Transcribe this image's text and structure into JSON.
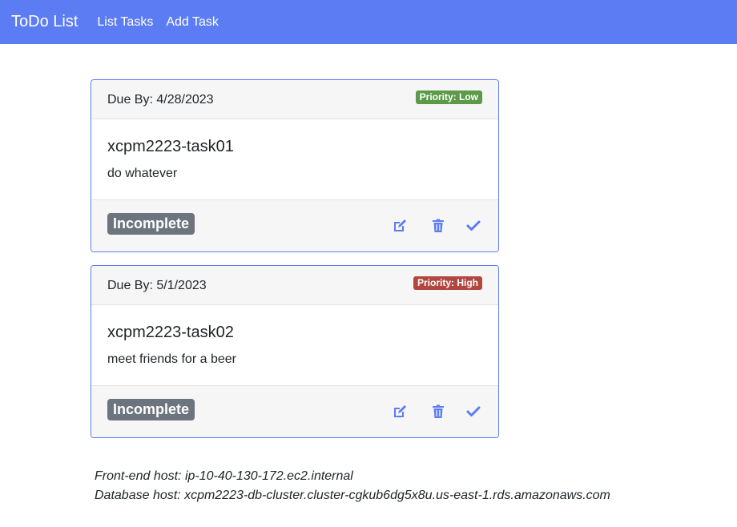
{
  "navbar": {
    "brand": "ToDo List",
    "links": [
      "List Tasks",
      "Add Task"
    ],
    "background": "#5c7cf4"
  },
  "tasks": [
    {
      "due_label": "Due By: 4/28/2023",
      "priority_label": "Priority: Low",
      "priority_color": "#5a9a48",
      "title": "xcpm2223-task01",
      "description": "do whatever",
      "status": "Incomplete",
      "actions": [
        "edit-icon",
        "trash-icon",
        "check-icon"
      ]
    },
    {
      "due_label": "Due By: 5/1/2023",
      "priority_label": "Priority: High",
      "priority_color": "#b2473f",
      "title": "xcpm2223-task02",
      "description": "meet friends for a beer",
      "status": "Incomplete",
      "actions": [
        "edit-icon",
        "trash-icon",
        "check-icon"
      ]
    }
  ],
  "hosts": {
    "frontend": "Front-end host: ip-10-40-130-172.ec2.internal",
    "database": "Database host: xcpm2223-db-cluster.cluster-cgkub6dg5x8u.us-east-1.rds.amazonaws.com"
  },
  "colors": {
    "accent": "#5c7cf4",
    "status_badge": "#6c757d",
    "icon": "#5c7cf4"
  }
}
